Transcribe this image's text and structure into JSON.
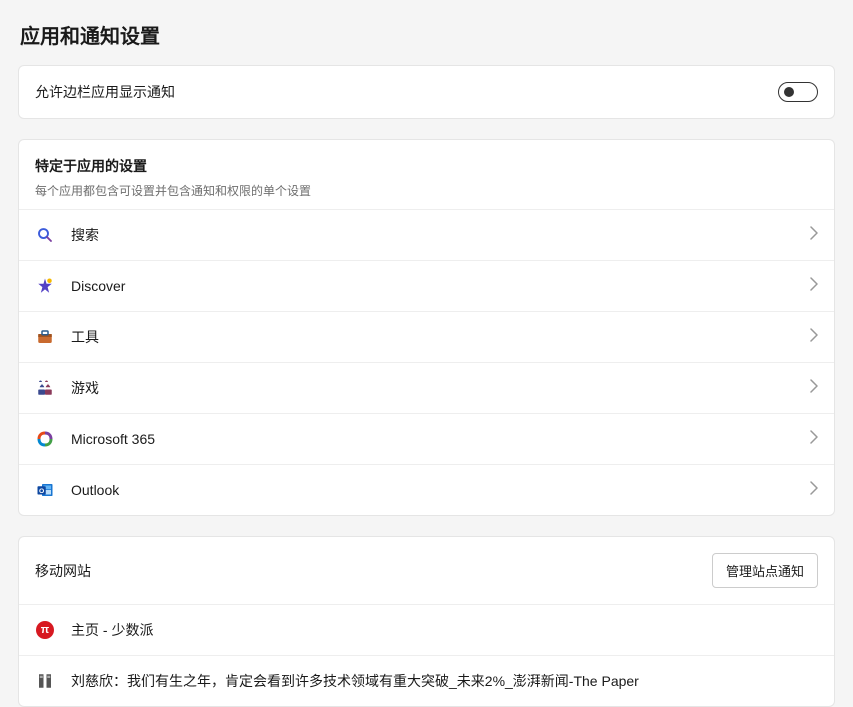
{
  "page_title": "应用和通知设置",
  "toggle": {
    "label": "允许边栏应用显示通知",
    "state": "off"
  },
  "app_section": {
    "title": "特定于应用的设置",
    "subtitle": "每个应用都包含可设置并包含通知和权限的单个设置",
    "apps": [
      {
        "id": "search",
        "label": "搜索",
        "icon": "search-icon"
      },
      {
        "id": "discover",
        "label": "Discover",
        "icon": "discover-icon"
      },
      {
        "id": "tools",
        "label": "工具",
        "icon": "tools-icon"
      },
      {
        "id": "games",
        "label": "游戏",
        "icon": "games-icon"
      },
      {
        "id": "m365",
        "label": "Microsoft 365",
        "icon": "m365-icon"
      },
      {
        "id": "outlook",
        "label": "Outlook",
        "icon": "outlook-icon"
      }
    ]
  },
  "mobile_section": {
    "title": "移动网站",
    "manage_button": "管理站点通知",
    "sites": [
      {
        "id": "sspai",
        "label": "主页 - 少数派",
        "icon": "sspai-icon"
      },
      {
        "id": "thepaper",
        "label": "刘慈欣：我们有生之年，肯定会看到许多技术领域有重大突破_未来2%_澎湃新闻-The Paper",
        "icon": "thepaper-icon"
      }
    ]
  }
}
